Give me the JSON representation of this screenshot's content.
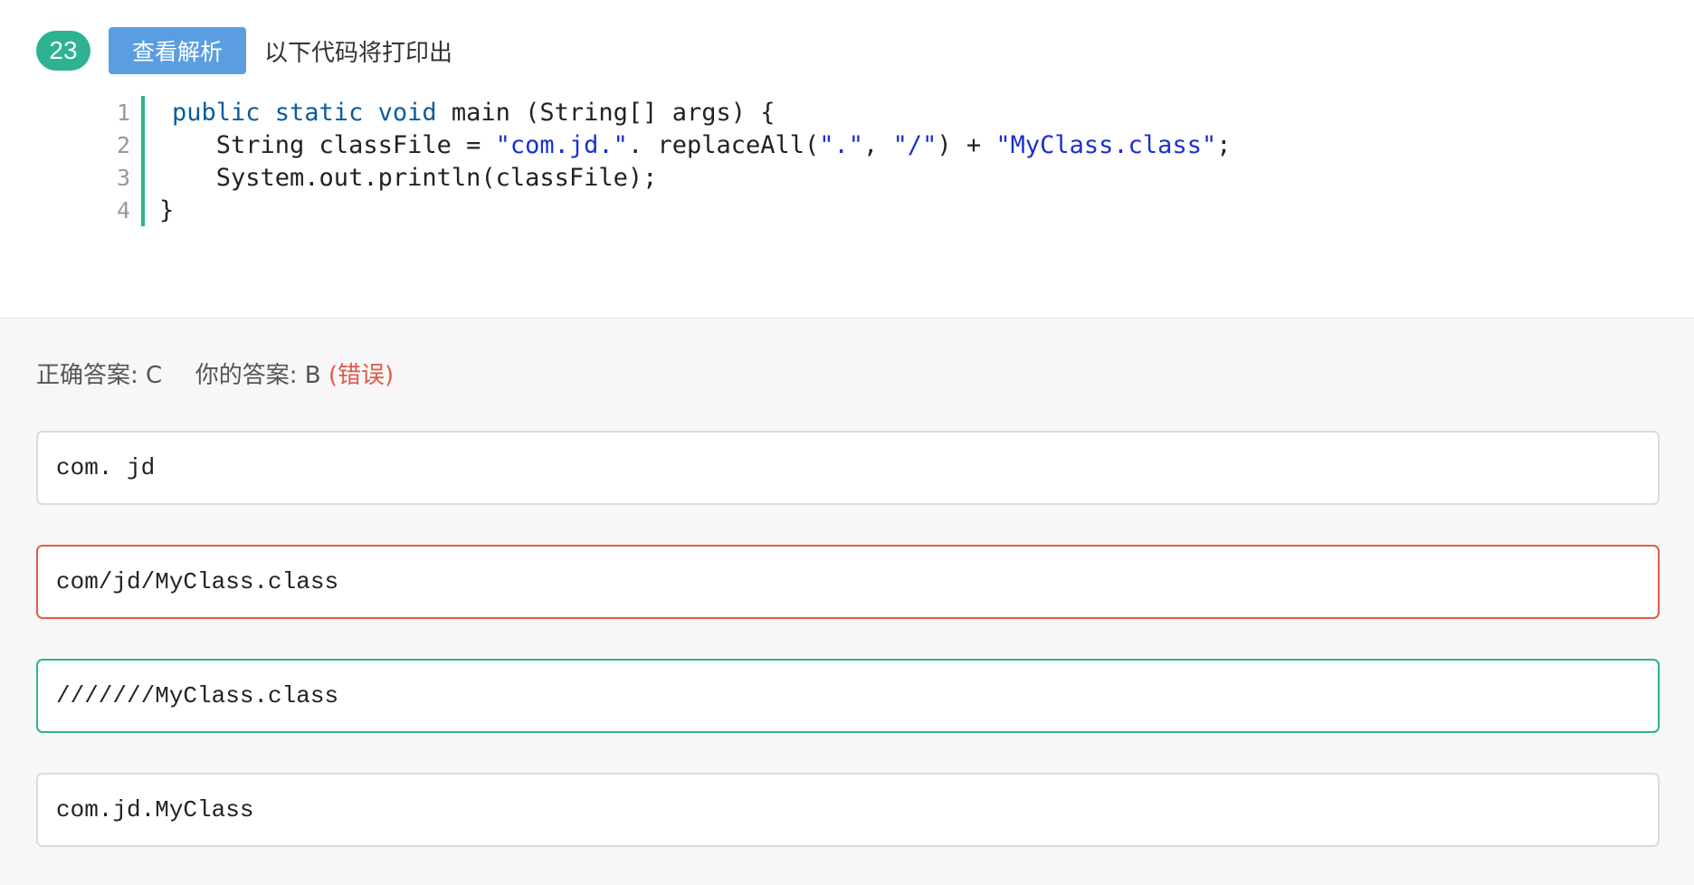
{
  "question": {
    "number": "23",
    "view_analysis_label": "查看解析",
    "prompt": "以下代码将打印出"
  },
  "code": {
    "line_numbers": [
      "1",
      "2",
      "3",
      "4"
    ],
    "lines": [
      [
        {
          "t": "public static void",
          "c": "kw"
        },
        {
          "t": " main (String[] args) {",
          "c": ""
        }
      ],
      [
        {
          "t": "   String classFile = ",
          "c": ""
        },
        {
          "t": "\"com.jd.\"",
          "c": "str"
        },
        {
          "t": ". replaceAll(",
          "c": ""
        },
        {
          "t": "\".\"",
          "c": "str"
        },
        {
          "t": ", ",
          "c": ""
        },
        {
          "t": "\"/\"",
          "c": "str"
        },
        {
          "t": ") + ",
          "c": ""
        },
        {
          "t": "\"MyClass.class\"",
          "c": "str"
        },
        {
          "t": ";",
          "c": ""
        }
      ],
      [
        {
          "t": "   System.out.println(classFile);",
          "c": ""
        }
      ],
      [
        {
          "t": "}",
          "c": ""
        }
      ]
    ]
  },
  "result": {
    "correct_label": "正确答案: C",
    "your_label": "你的答案: B",
    "status": "(错误)"
  },
  "options": [
    {
      "text": "com. jd",
      "state": "normal"
    },
    {
      "text": "com/jd/MyClass.class",
      "state": "wrong"
    },
    {
      "text": "///////MyClass.class",
      "state": "correct"
    },
    {
      "text": "com.jd.MyClass",
      "state": "normal"
    }
  ],
  "colors": {
    "accent_green": "#2db391",
    "button_blue": "#5b9ee0",
    "error_red": "#e35b4a",
    "keyword": "#0a5c9b",
    "string": "#1a2fd1"
  }
}
